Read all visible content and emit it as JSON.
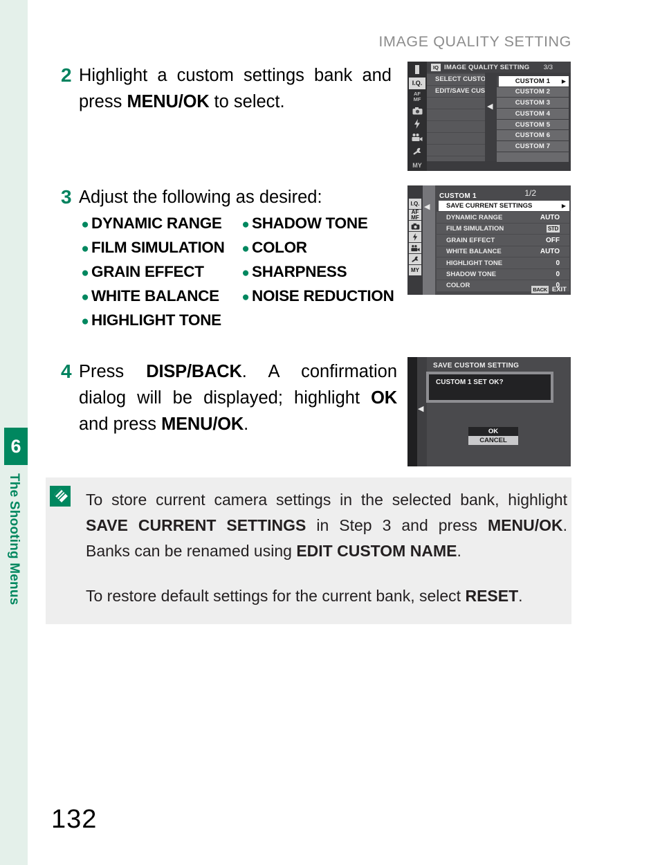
{
  "chapter": {
    "number": "6",
    "title": "The Shooting Menus"
  },
  "header": {
    "title": "IMAGE QUALITY SETTING"
  },
  "page_number": "132",
  "steps": {
    "step2": {
      "number": "2",
      "text_1": "Highlight a custom settings bank and press ",
      "bold_1": "MENU/OK",
      "text_2": " to select."
    },
    "step3": {
      "number": "3",
      "heading": "Adjust the following as desired:",
      "bullets_left": [
        "DYNAMIC RANGE",
        "FILM SIMULATION",
        "GRAIN EFFECT",
        "WHITE BALANCE",
        "HIGHLIGHT TONE"
      ],
      "bullets_right": [
        "SHADOW TONE",
        "COLOR",
        "SHARPNESS",
        "NOISE REDUCTION"
      ]
    },
    "step4": {
      "number": "4",
      "text_1": "Press ",
      "bold_1": "DISP/BACK",
      "text_2": ". A confirmation dialog will be displayed; highlight ",
      "bold_2": "OK",
      "text_3": " and press ",
      "bold_3": "MENU/OK",
      "text_4": "."
    }
  },
  "note": {
    "icon_name": "note-pencil-icon",
    "p1_a": "To store current camera settings in the selected bank, highlight ",
    "p1_b": "SAVE CURRENT SETTINGS",
    "p1_c": " in Step 3 and press ",
    "p1_d": "MENU/OK",
    "p1_e": ". Banks can be renamed using ",
    "p1_f": "EDIT CUSTOM NAME",
    "p1_g": ".",
    "p2_a": "To restore default settings for the current bank, select ",
    "p2_b": "RESET",
    "p2_c": "."
  },
  "screens": {
    "shot1": {
      "badge": "IQ",
      "title": "IMAGE QUALITY SETTING",
      "page_indicator": "3/3",
      "menu_rows": [
        "SELECT CUSTOM SETTING",
        "EDIT/SAVE CUSTOM NAME",
        "",
        "",
        "",
        "",
        "",
        ""
      ],
      "rail_icons": [
        "tab-marker-icon",
        "image-quality-icon",
        "af-mf-icon",
        "shooting-setting-icon",
        "flash-icon",
        "movie-icon",
        "wrench-setup-icon",
        "my-menu-icon"
      ],
      "rail_labels": [
        "",
        "I.Q.",
        "AF\nMF",
        "",
        "",
        "",
        "",
        "MY"
      ],
      "submenu_items": [
        "CUSTOM 1",
        "CUSTOM 2",
        "CUSTOM 3",
        "CUSTOM 4",
        "CUSTOM 5",
        "CUSTOM 6",
        "CUSTOM 7",
        ""
      ],
      "selected_index": 0
    },
    "shot2": {
      "title": "CUSTOM 1",
      "page_indicator": "1/2",
      "rows": [
        {
          "label": "SAVE CURRENT SETTINGS",
          "value": "",
          "selected": true
        },
        {
          "label": "DYNAMIC RANGE",
          "value": "AUTO",
          "selected": false
        },
        {
          "label": "FILM SIMULATION",
          "value": "STD",
          "value_is_badge": true,
          "selected": false
        },
        {
          "label": "GRAIN EFFECT",
          "value": "OFF",
          "selected": false
        },
        {
          "label": "WHITE BALANCE",
          "value": "AUTO",
          "selected": false
        },
        {
          "label": "HIGHLIGHT TONE",
          "value": "0",
          "selected": false
        },
        {
          "label": "SHADOW TONE",
          "value": "0",
          "selected": false
        },
        {
          "label": "COLOR",
          "value": "0",
          "selected": false
        }
      ],
      "footer_badge": "BACK",
      "footer_label": "EXIT",
      "rail_labels": [
        "I.Q.",
        "AF\nMF",
        "",
        "",
        "",
        "",
        "MY"
      ]
    },
    "shot3": {
      "title": "SAVE CUSTOM SETTING",
      "message": "CUSTOM 1 SET OK?",
      "button_ok": "OK",
      "button_cancel": "CANCEL"
    }
  },
  "colors": {
    "accent_green": "#00875f",
    "rail_tint": "#e4f0ea",
    "note_bg": "#eeeeee",
    "header_gray": "#8c8c8c"
  }
}
